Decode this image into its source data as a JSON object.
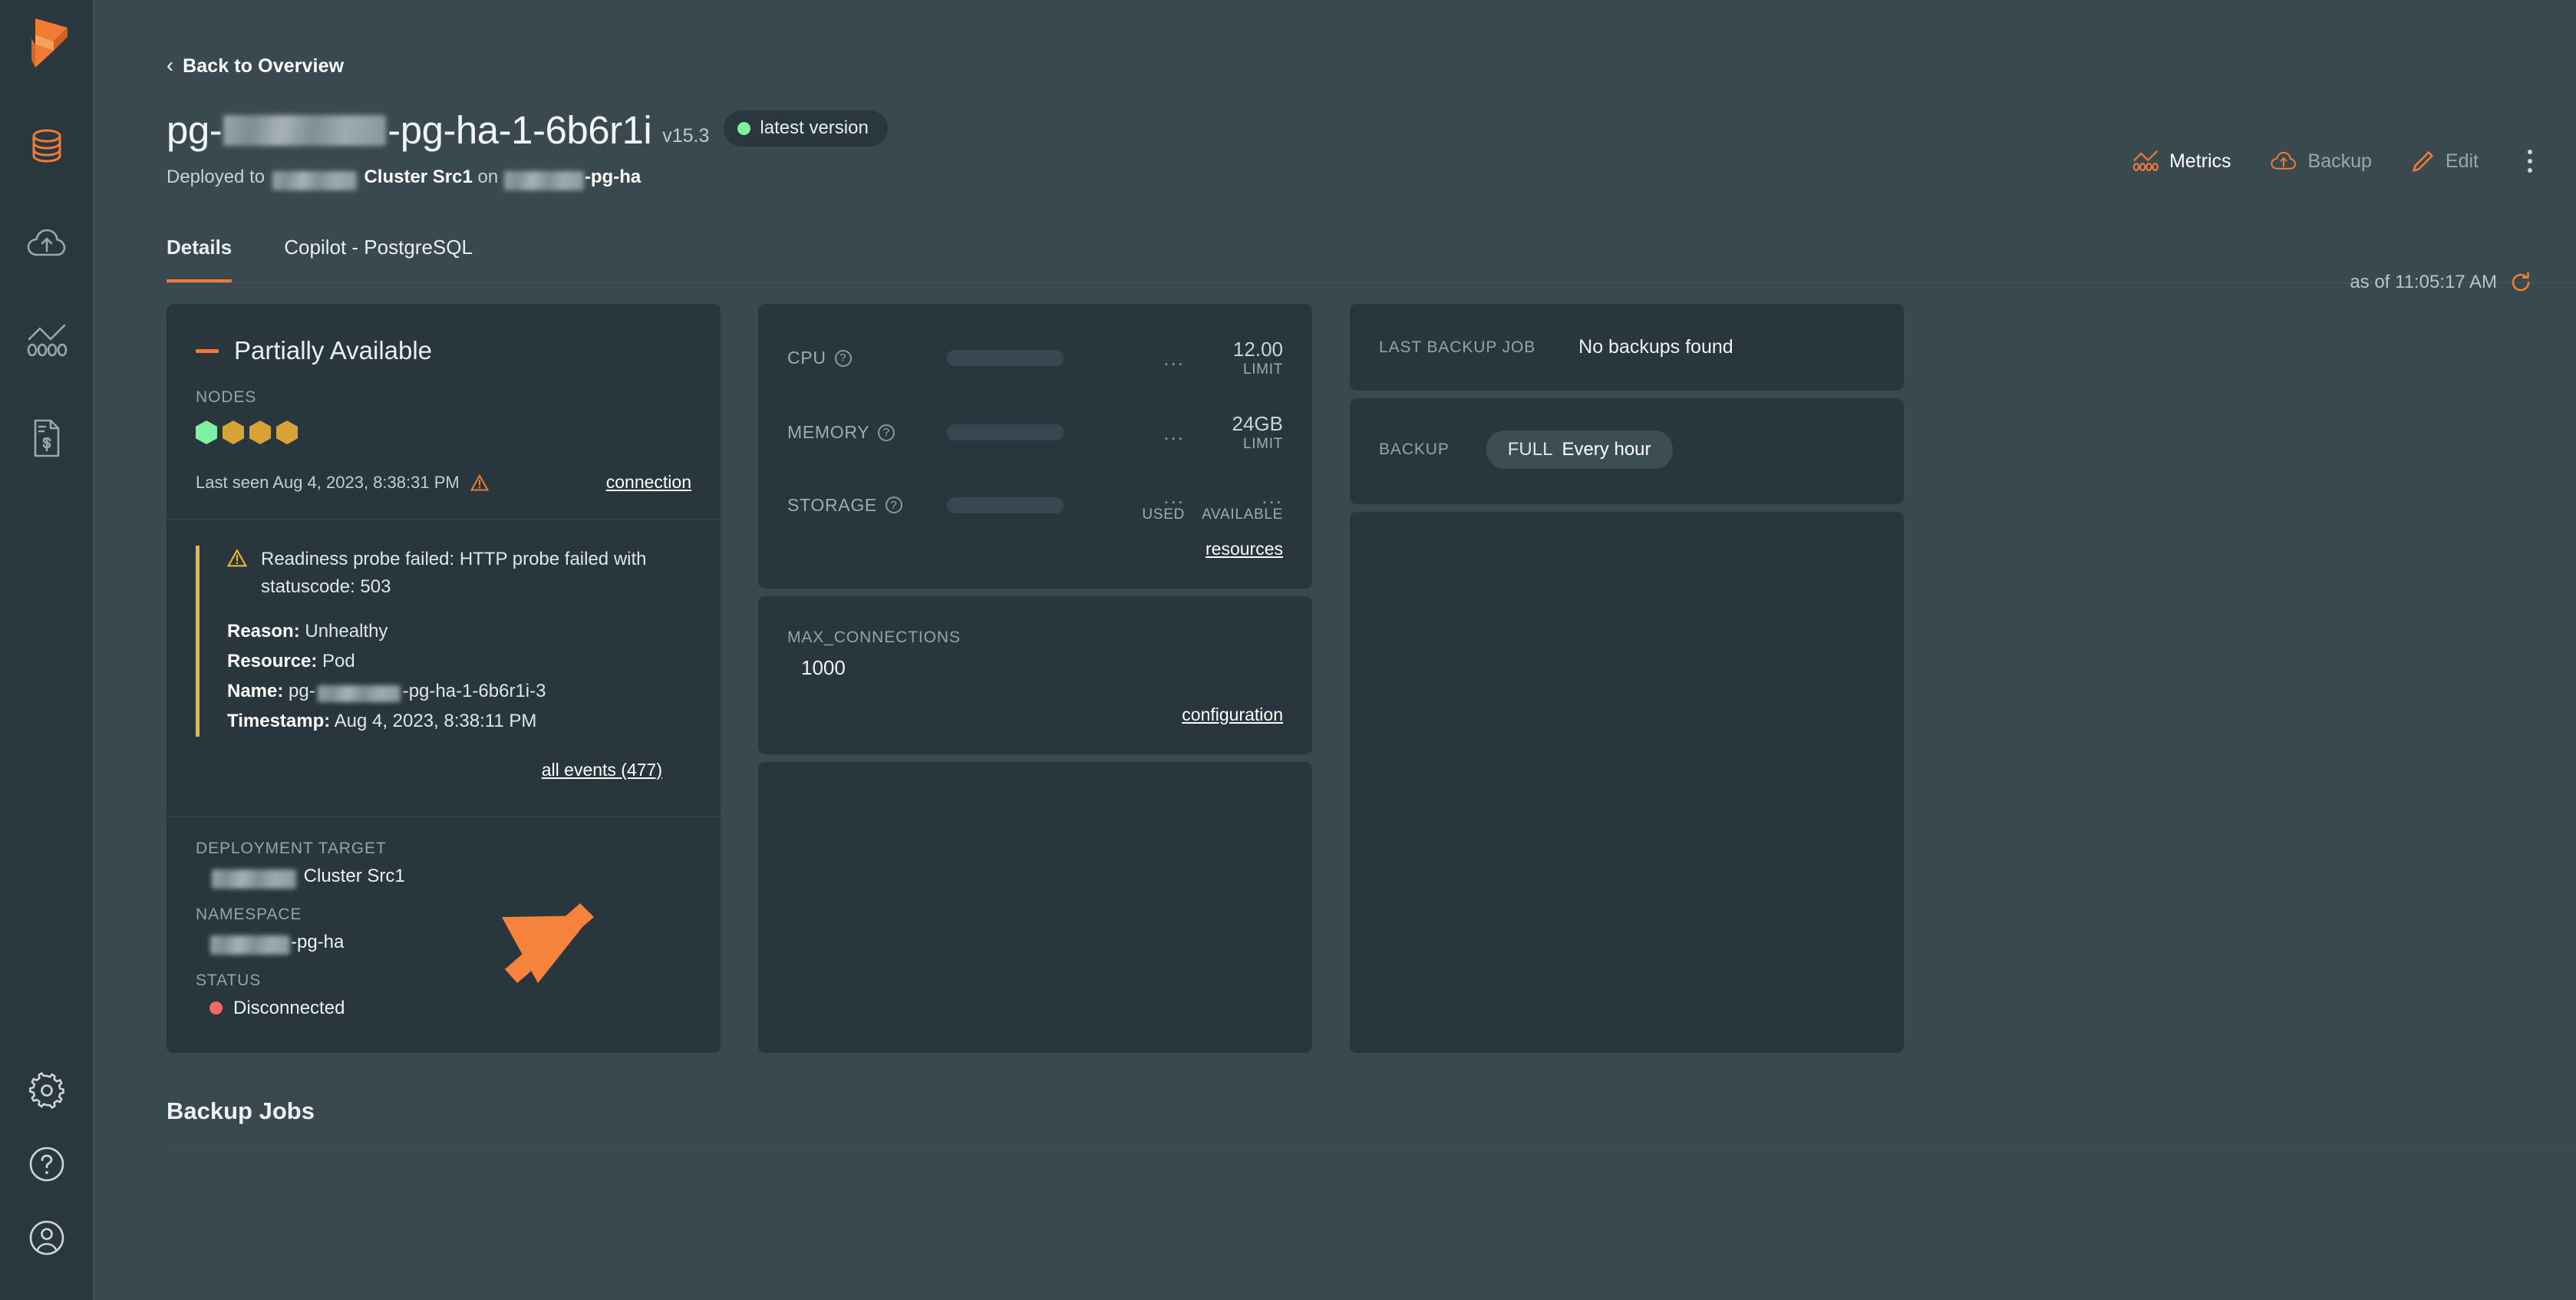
{
  "sidebar": {
    "logo": "prisma-ribbon-logo",
    "items": [
      {
        "name": "databases",
        "icon": "database-icon",
        "active": true
      },
      {
        "name": "backups",
        "icon": "cloud-upload-icon",
        "active": false
      },
      {
        "name": "metrics",
        "icon": "chart-metrics-icon",
        "active": false
      },
      {
        "name": "billing",
        "icon": "document-dollar-icon",
        "active": false
      }
    ],
    "bottom_items": [
      {
        "name": "settings",
        "icon": "gear-icon"
      },
      {
        "name": "help",
        "icon": "question-circle-icon"
      },
      {
        "name": "account",
        "icon": "user-circle-icon"
      }
    ]
  },
  "header": {
    "back_label": "Back to Overview",
    "title_prefix": "pg-",
    "title_suffix": "-pg-ha-1-6b6r1i",
    "version": "v15.3",
    "version_badge": "latest version",
    "deployed_prefix": "Deployed to",
    "deployed_cluster": "Cluster Src1",
    "deployed_on": "on",
    "deployed_namespace_suffix": "-pg-ha",
    "actions": [
      {
        "label": "Metrics",
        "icon": "metrics-icon",
        "state": "active"
      },
      {
        "label": "Backup",
        "icon": "cloud-upload-icon",
        "state": "muted"
      },
      {
        "label": "Edit",
        "icon": "pencil-icon",
        "state": "muted"
      }
    ],
    "kebab": "more-options-icon",
    "as_of": "as of 11:05:17 AM",
    "refresh_icon": "refresh-icon"
  },
  "tabs": [
    {
      "label": "Details",
      "active": true
    },
    {
      "label": "Copilot - PostgreSQL",
      "active": false
    }
  ],
  "status_card": {
    "status": "Partially Available",
    "nodes_label": "NODES",
    "nodes": [
      {
        "state": "healthy",
        "color": "#7ef2a0"
      },
      {
        "state": "warning",
        "color": "#d6a334"
      },
      {
        "state": "warning",
        "color": "#d6a334"
      },
      {
        "state": "warning",
        "color": "#d6a334"
      }
    ],
    "last_seen": "Last seen Aug 4, 2023, 8:38:31 PM",
    "last_seen_icon": "warning-triangle-icon",
    "connection_link": "connection",
    "event": {
      "icon": "warning-triangle-icon",
      "message": "Readiness probe failed: HTTP probe failed with statuscode: 503",
      "reason_key": "Reason:",
      "reason_value": "Unhealthy",
      "resource_key": "Resource:",
      "resource_value": "Pod",
      "name_key": "Name:",
      "name_prefix": "pg-",
      "name_suffix": "-pg-ha-1-6b6r1i-3",
      "timestamp_key": "Timestamp:",
      "timestamp_value": "Aug 4, 2023, 8:38:11 PM",
      "all_events_link": "all events (477)"
    },
    "deployment_target_label": "DEPLOYMENT TARGET",
    "deployment_target_value": "Cluster Src1",
    "namespace_label": "NAMESPACE",
    "namespace_value_suffix": "-pg-ha",
    "status_label": "STATUS",
    "status_value": "Disconnected",
    "status_color": "#f06a6a"
  },
  "resources_card": {
    "rows": [
      {
        "name": "CPU",
        "help": "?",
        "used": "...",
        "value": "12.00",
        "sub": "LIMIT"
      },
      {
        "name": "MEMORY",
        "help": "?",
        "used": "...",
        "value": "24GB",
        "sub": "LIMIT"
      },
      {
        "name": "STORAGE",
        "help": "?",
        "used": "...",
        "value": "...",
        "sub_used": "USED",
        "sub_available": "AVAILABLE"
      }
    ],
    "resources_link": "resources"
  },
  "config_card": {
    "label": "MAX_CONNECTIONS",
    "value": "1000",
    "configuration_link": "configuration"
  },
  "backup_card": {
    "last_backup_job_label": "LAST BACKUP JOB",
    "last_backup_job_value": "No backups found",
    "backup_label": "BACKUP",
    "backup_type": "FULL",
    "backup_schedule": "Every hour"
  },
  "footer": {
    "backup_jobs_title": "Backup Jobs"
  },
  "colors": {
    "accent": "#ef7b35",
    "warning": "#e8b63c",
    "danger": "#f06a6a",
    "success": "#7ef2a0"
  },
  "annotation": {
    "type": "arrow",
    "color": "#f5833c",
    "points_to": "all events (477)"
  }
}
